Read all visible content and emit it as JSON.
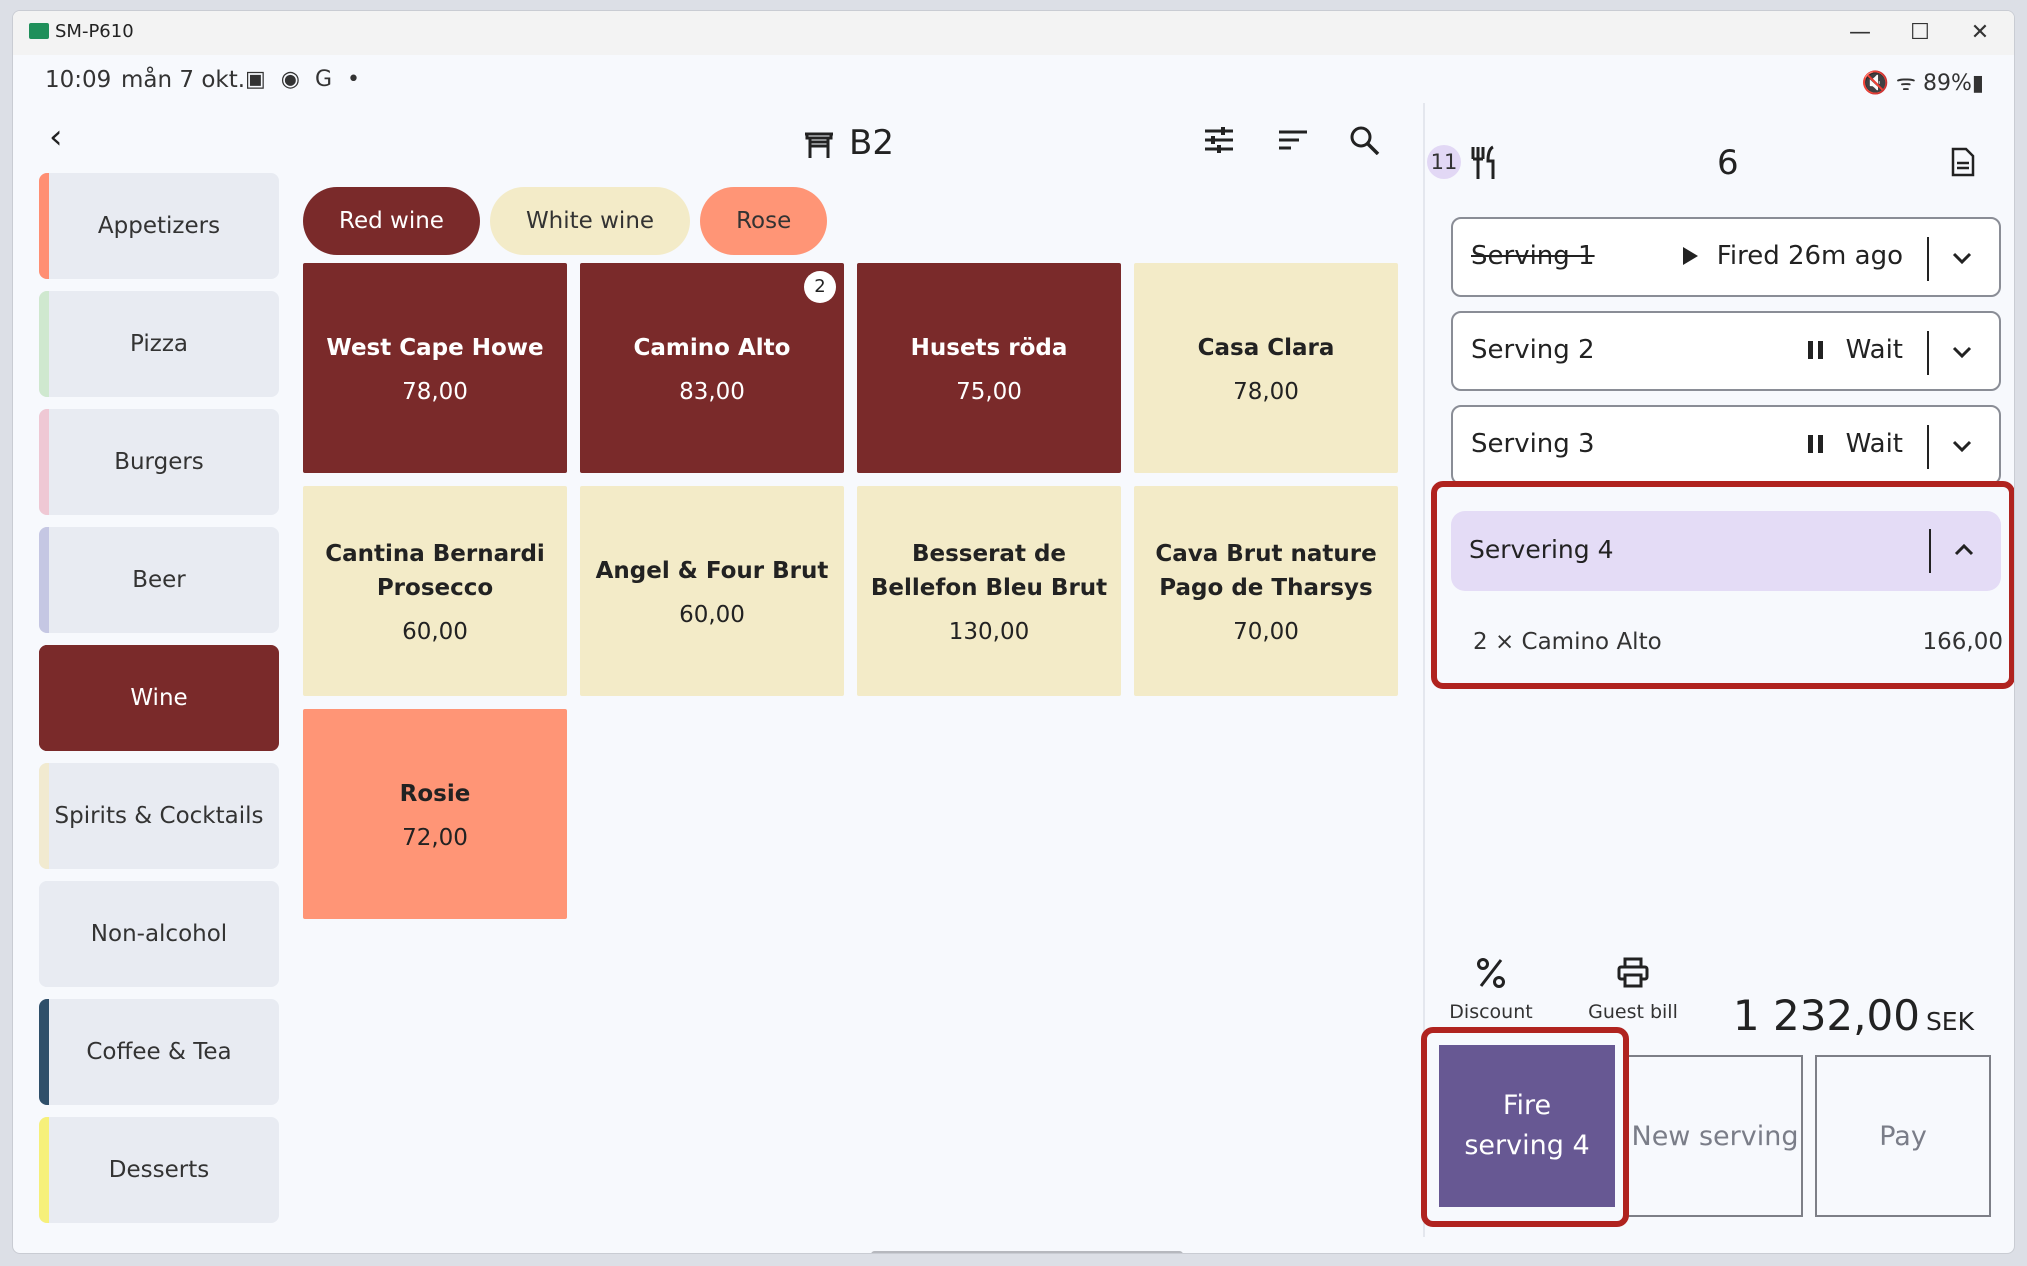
{
  "window": {
    "title": "SM-P610"
  },
  "statusbar": {
    "time": "10:09",
    "date": "mån 7 okt.",
    "notif_icons": "▣ ◉ G •",
    "right": "🔇 ᯤ 89%▮"
  },
  "header": {
    "table": "B2"
  },
  "categories": [
    {
      "label": "Appetizers",
      "color": "#ff8f73"
    },
    {
      "label": "Pizza",
      "color": "#cfe8cf"
    },
    {
      "label": "Burgers",
      "color": "#efc8d4"
    },
    {
      "label": "Beer",
      "color": "#c5c7e3"
    },
    {
      "label": "Wine",
      "color": "#7a2a2a"
    },
    {
      "label": "Spirits & Cocktails",
      "color": "#f1ead0"
    },
    {
      "label": "Non-alcohol",
      "color": "#e8ebf2"
    },
    {
      "label": "Coffee & Tea",
      "color": "#2f4f6a"
    },
    {
      "label": "Desserts",
      "color": "#f6f07a"
    }
  ],
  "subcategories": [
    {
      "label": "Red wine",
      "bg": "#7a2a2a",
      "fg": "#ffffff"
    },
    {
      "label": "White wine",
      "bg": "#f3ebc8",
      "fg": "#333333"
    },
    {
      "label": "Rose",
      "bg": "#ff9576",
      "fg": "#333333"
    }
  ],
  "products": [
    {
      "name": "West Cape Howe",
      "price": "78,00",
      "style": "red"
    },
    {
      "name": "Camino Alto",
      "price": "83,00",
      "style": "red",
      "badge": "2"
    },
    {
      "name": "Husets röda",
      "price": "75,00",
      "style": "red"
    },
    {
      "name": "Casa Clara",
      "price": "78,00",
      "style": "white"
    },
    {
      "name": "Cantina Bernardi Prosecco",
      "price": "60,00",
      "style": "white"
    },
    {
      "name": "Angel & Four Brut",
      "price": "60,00",
      "style": "white"
    },
    {
      "name": "Besserat de Bellefon Bleu Brut",
      "price": "130,00",
      "style": "white"
    },
    {
      "name": "Cava Brut nature Pago de Tharsys",
      "price": "70,00",
      "style": "white"
    },
    {
      "name": "Rosie",
      "price": "72,00",
      "style": "rose"
    }
  ],
  "order": {
    "guests": "11",
    "sequence": "6",
    "servings": [
      {
        "name": "Serving 1",
        "status": "Fired 26m ago",
        "icon": "play",
        "done": true
      },
      {
        "name": "Serving 2",
        "status": "Wait",
        "icon": "pause",
        "done": false
      },
      {
        "name": "Serving 3",
        "status": "Wait",
        "icon": "pause",
        "done": false
      }
    ],
    "active_serving": {
      "name": "Servering 4"
    },
    "line": {
      "qty": "2 ×",
      "name": "Camino Alto",
      "price": "166,00"
    },
    "discount_label": "Discount",
    "guest_bill_label": "Guest bill",
    "total": "1 232,00",
    "currency": "SEK",
    "fire_label": "Fire serving 4",
    "new_serving_label": "New serving",
    "pay_label": "Pay"
  },
  "colors": {
    "red": "#7a2a2a",
    "white": "#f3ebc8",
    "rose": "#ff9576",
    "primary": "#675893",
    "highlight": "#b0231f"
  }
}
